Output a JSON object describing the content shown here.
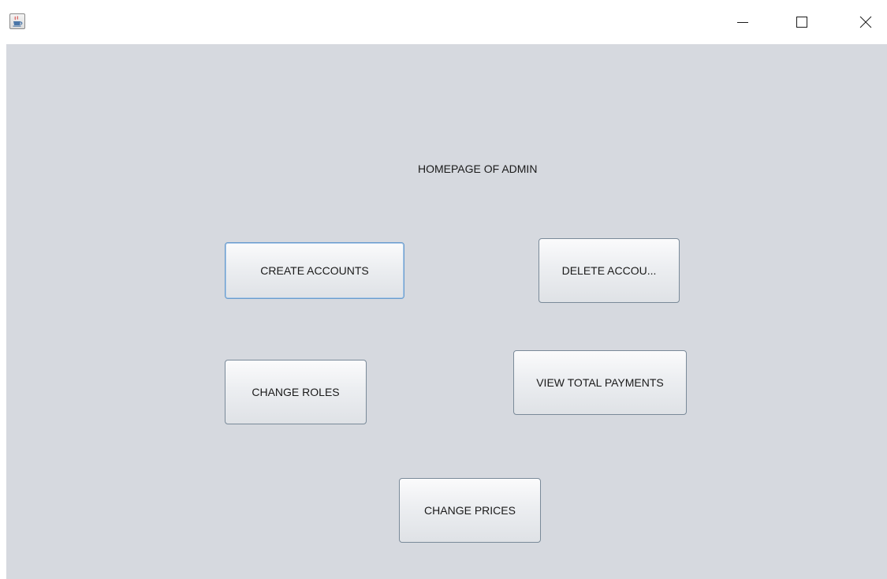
{
  "window": {
    "heading": "HOMEPAGE OF ADMIN"
  },
  "titlebar": {
    "icons": {
      "app": "java-cup-icon",
      "minimize": "minimize-icon",
      "maximize": "maximize-icon",
      "close": "close-icon"
    }
  },
  "buttons": {
    "create_accounts": "CREATE ACCOUNTS",
    "delete_accounts": "DELETE ACCOU...",
    "change_roles": "CHANGE ROLES",
    "view_total_payments": "VIEW TOTAL PAYMENTS",
    "change_prices": "CHANGE PRICES"
  },
  "colors": {
    "content_background": "#d6d9df",
    "focus_border": "#6a9ccd"
  }
}
